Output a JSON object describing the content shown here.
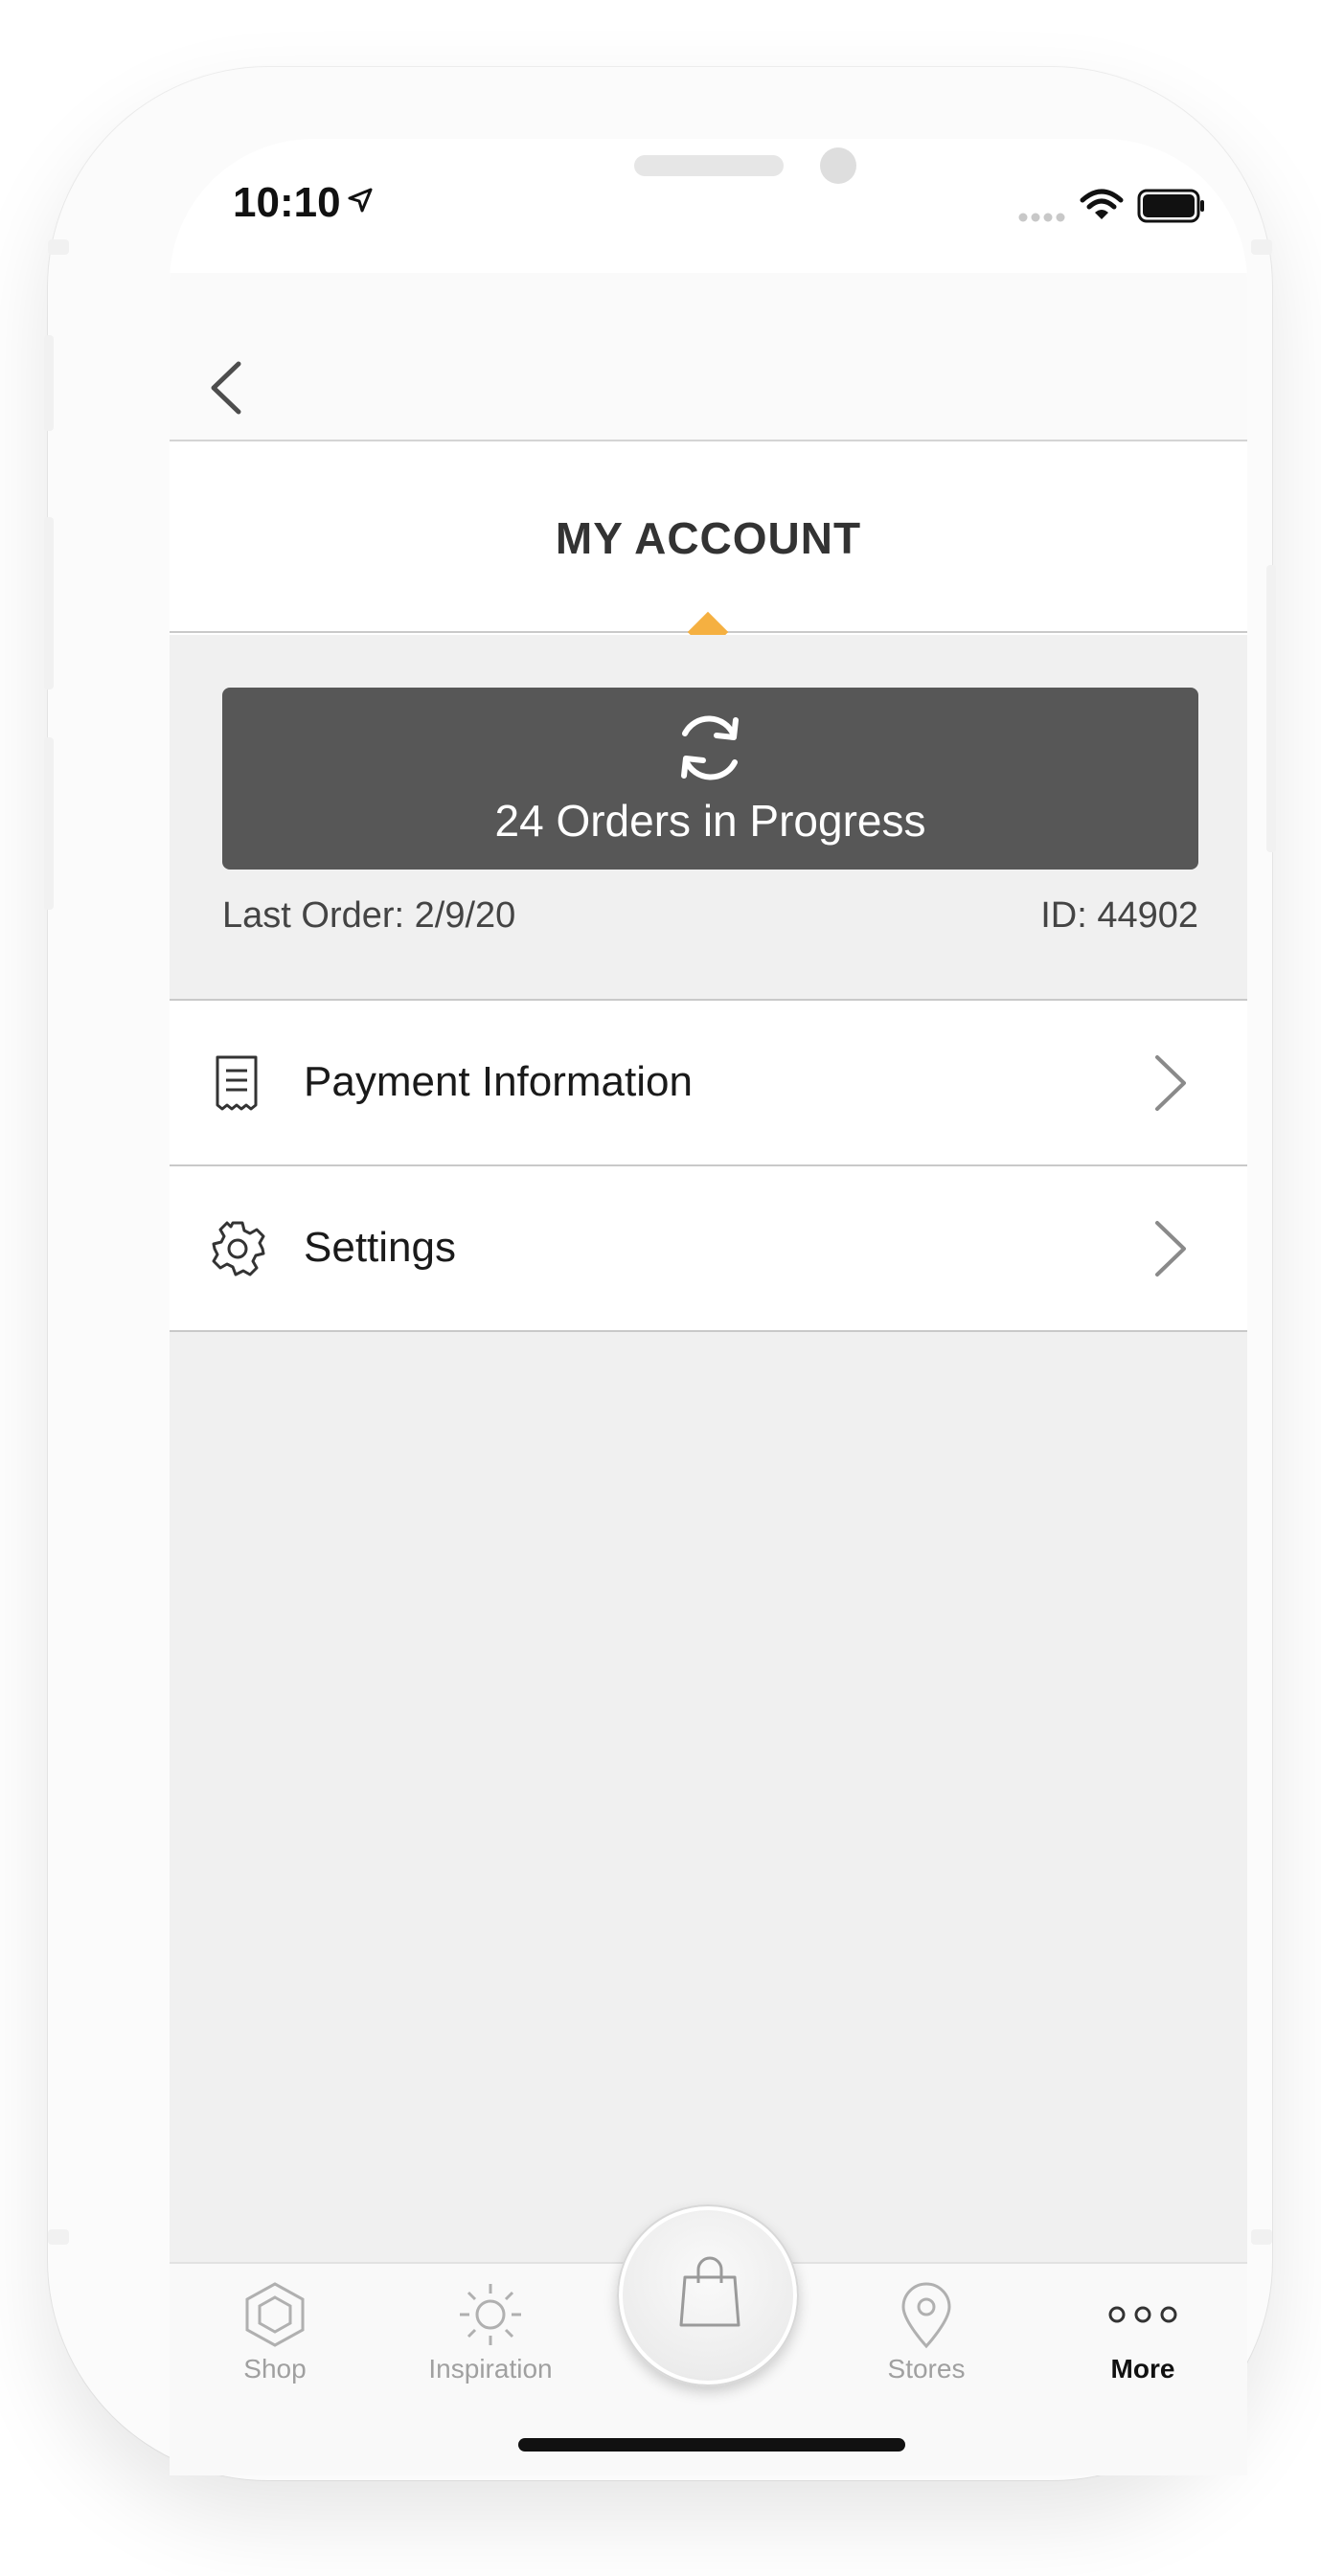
{
  "status_bar": {
    "time": "10:10",
    "icons": [
      "location-arrow-icon",
      "signal-icon",
      "wifi-icon",
      "battery-icon"
    ]
  },
  "nav": {
    "back_icon": "chevron-left-icon"
  },
  "header": {
    "title": "MY ACCOUNT",
    "accent_color": "#f5b041"
  },
  "orders": {
    "icon": "refresh-icon",
    "label": "24 Orders in Progress",
    "background": "#575757"
  },
  "order_meta": {
    "last_order": "Last Order: 2/9/20",
    "id": "ID: 44902"
  },
  "menu": {
    "items": [
      {
        "label": "Payment Information",
        "icon": "receipt-icon"
      },
      {
        "label": "Settings",
        "icon": "gear-icon"
      }
    ]
  },
  "tabs": {
    "items": [
      {
        "label": "Shop",
        "icon": "hexagon-icon",
        "active": false
      },
      {
        "label": "Inspiration",
        "icon": "sun-icon",
        "active": false
      },
      {
        "label": "Stores",
        "icon": "map-pin-icon",
        "active": false
      },
      {
        "label": "More",
        "icon": "more-dots-icon",
        "active": true
      }
    ],
    "center_icon": "shopping-bag-icon"
  }
}
